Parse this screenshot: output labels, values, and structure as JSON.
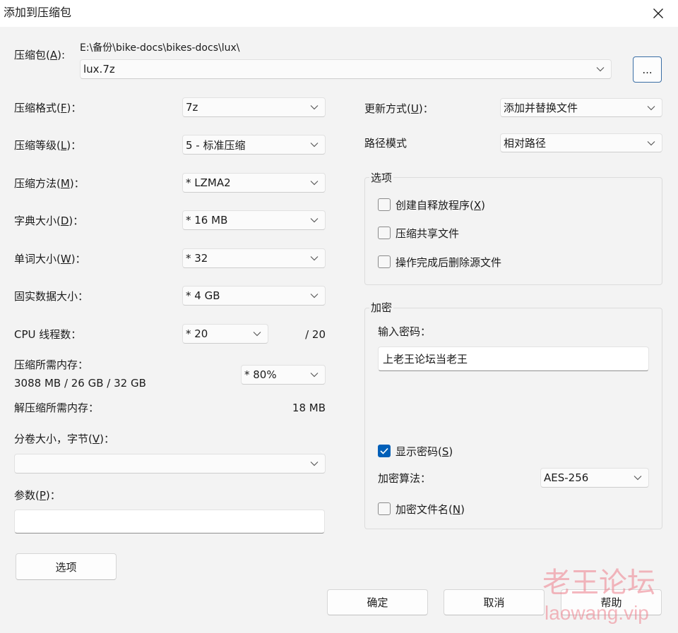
{
  "window": {
    "title": "添加到压缩包"
  },
  "archive": {
    "label": "压缩包(A):",
    "path": "E:\\备份\\bike-docs\\bikes-docs\\lux\\",
    "name": "lux.7z",
    "browse_label": "..."
  },
  "compression": {
    "format": {
      "label": "压缩格式(F)：",
      "value": "7z"
    },
    "level": {
      "label": "压缩等级(L)：",
      "value": "5 - 标准压缩"
    },
    "method": {
      "label": "压缩方法(M)：",
      "value": "* LZMA2"
    },
    "dictionary": {
      "label": "字典大小(D)：",
      "value": "* 16 MB"
    },
    "word": {
      "label": "单词大小(W)：",
      "value": "* 32"
    },
    "solid": {
      "label": "固实数据大小：",
      "value": "* 4 GB"
    },
    "threads": {
      "label": "CPU 线程数：",
      "value": "* 20",
      "max": "/ 20"
    },
    "memory": {
      "label": "压缩所需内存：",
      "usage": "3088 MB / 26 GB / 32 GB",
      "value": "* 80%"
    },
    "decompress_memory": {
      "label": "解压缩所需内存：",
      "value": "18 MB"
    },
    "volume": {
      "label": "分卷大小，字节(V)：",
      "value": ""
    },
    "params": {
      "label": "参数(P)：",
      "value": ""
    },
    "options_button": "选项"
  },
  "settings": {
    "update": {
      "label": "更新方式(U)：",
      "value": "添加并替换文件"
    },
    "path_mode": {
      "label": "路径模式",
      "value": "相对路径"
    },
    "options_group": {
      "title": "选项",
      "checkboxes": [
        {
          "label": "创建自释放程序(X)",
          "checked": false
        },
        {
          "label": "压缩共享文件",
          "checked": false
        },
        {
          "label": "操作完成后删除源文件",
          "checked": false
        }
      ]
    },
    "encryption": {
      "title": "加密",
      "password_label": "输入密码：",
      "password": "上老王论坛当老王",
      "show_password": {
        "label": "显示密码(S)",
        "checked": true
      },
      "method_label": "加密算法：",
      "method": "AES-256",
      "encrypt_names": {
        "label": "加密文件名(N)",
        "checked": false
      }
    }
  },
  "buttons": {
    "ok": "确定",
    "cancel": "取消",
    "help": "帮助"
  },
  "watermark": {
    "text": "老王论坛",
    "site": "laowang.vip"
  },
  "colors": {
    "accent": "#005fb8",
    "watermark": "#ee7f8c"
  }
}
